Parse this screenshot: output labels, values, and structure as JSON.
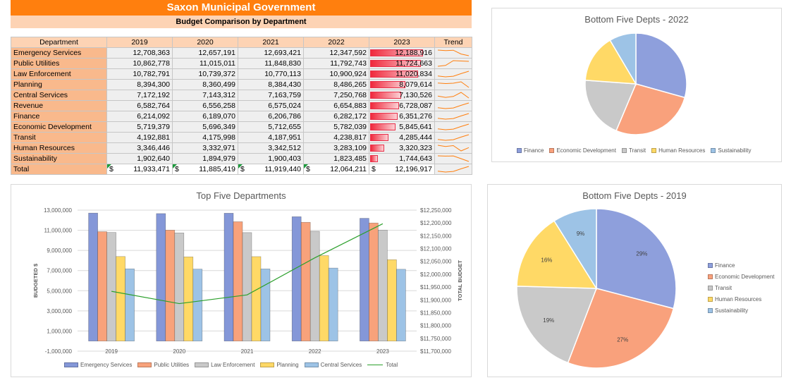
{
  "sheet": {
    "title": "Saxon Municipal Government",
    "subtitle": "Budget Comparison by Department",
    "columns": [
      "Department",
      "2019",
      "2020",
      "2021",
      "2022",
      "2023",
      "Trend"
    ],
    "rows": [
      {
        "dept": "Emergency Services",
        "vals": [
          "12,708,363",
          "12,657,191",
          "12,693,421",
          "12,347,592",
          "12,188,916"
        ],
        "v2023": 12188916,
        "trend": [
          12708363,
          12657191,
          12693421,
          12347592,
          12188916
        ]
      },
      {
        "dept": "Public Utilities",
        "vals": [
          "10,862,778",
          "11,015,011",
          "11,848,830",
          "11,792,743",
          "11,724,663"
        ],
        "v2023": 11724663,
        "trend": [
          10862778,
          11015011,
          11848830,
          11792743,
          11724663
        ]
      },
      {
        "dept": "Law Enforcement",
        "vals": [
          "10,782,791",
          "10,739,372",
          "10,770,113",
          "10,900,924",
          "11,020,834"
        ],
        "v2023": 11020834,
        "trend": [
          10782791,
          10739372,
          10770113,
          10900924,
          11020834
        ]
      },
      {
        "dept": "Planning",
        "vals": [
          "8,394,300",
          "8,360,499",
          "8,384,430",
          "8,486,265",
          "8,079,614"
        ],
        "v2023": 8079614,
        "trend": [
          8394300,
          8360499,
          8384430,
          8486265,
          8079614
        ]
      },
      {
        "dept": "Central Services",
        "vals": [
          "7,172,192",
          "7,143,312",
          "7,163,759",
          "7,250,768",
          "7,130,526"
        ],
        "v2023": 7130526,
        "trend": [
          7172192,
          7143312,
          7163759,
          7250768,
          7130526
        ]
      },
      {
        "dept": "Revenue",
        "vals": [
          "6,582,764",
          "6,556,258",
          "6,575,024",
          "6,654,883",
          "6,728,087"
        ],
        "v2023": 6728087,
        "trend": [
          6582764,
          6556258,
          6575024,
          6654883,
          6728087
        ]
      },
      {
        "dept": "Finance",
        "vals": [
          "6,214,092",
          "6,189,070",
          "6,206,786",
          "6,282,172",
          "6,351,276"
        ],
        "v2023": 6351276,
        "trend": [
          6214092,
          6189070,
          6206786,
          6282172,
          6351276
        ]
      },
      {
        "dept": "Economic Development",
        "vals": [
          "5,719,379",
          "5,696,349",
          "5,712,655",
          "5,782,039",
          "5,845,641"
        ],
        "v2023": 5845641,
        "trend": [
          5719379,
          5696349,
          5712655,
          5782039,
          5845641
        ]
      },
      {
        "dept": "Transit",
        "vals": [
          "4,192,881",
          "4,175,998",
          "4,187,951",
          "4,238,817",
          "4,285,444"
        ],
        "v2023": 4285444,
        "trend": [
          4192881,
          4175998,
          4187951,
          4238817,
          4285444
        ]
      },
      {
        "dept": "Human Resources",
        "vals": [
          "3,346,446",
          "3,332,971",
          "3,342,512",
          "3,283,109",
          "3,320,323"
        ],
        "v2023": 3320323,
        "trend": [
          3346446,
          3332971,
          3342512,
          3283109,
          3320323
        ]
      },
      {
        "dept": "Sustainability",
        "vals": [
          "1,902,640",
          "1,894,979",
          "1,900,403",
          "1,823,485",
          "1,744,643"
        ],
        "v2023": 1744643,
        "trend": [
          1902640,
          1894979,
          1900403,
          1823485,
          1744643
        ]
      }
    ],
    "total": {
      "dept": "Total",
      "currency": "$",
      "vals": [
        "11,933,471",
        "11,885,419",
        "11,919,440",
        "12,064,211",
        "12,196,917"
      ],
      "trend": [
        11933471,
        11885419,
        11919440,
        12064211,
        12196917
      ]
    },
    "colors": {
      "header_orange": "#ff7f0e",
      "dept_fill": "#f9b98c",
      "databar_red": "#f0283c",
      "sparkline": "#ff7f0e"
    }
  },
  "chart_data": [
    {
      "type": "bar",
      "title": "Top Five Departments",
      "categories": [
        "2019",
        "2020",
        "2021",
        "2022",
        "2023"
      ],
      "series": [
        {
          "name": "Emergency Services",
          "values": [
            12708363,
            12657191,
            12693421,
            12347592,
            12188916
          ],
          "color": "#8497d8"
        },
        {
          "name": "Public Utilities",
          "values": [
            10862778,
            11015011,
            11848830,
            11792743,
            11724663
          ],
          "color": "#f8a27b"
        },
        {
          "name": "Law Enforcement",
          "values": [
            10782791,
            10739372,
            10770113,
            10900924,
            11020834
          ],
          "color": "#c9c9c9"
        },
        {
          "name": "Planning",
          "values": [
            8394300,
            8360499,
            8384430,
            8486265,
            8079614
          ],
          "color": "#ffd966"
        },
        {
          "name": "Central Services",
          "values": [
            7172192,
            7143312,
            7163759,
            7250768,
            7130526
          ],
          "color": "#9dc3e6"
        }
      ],
      "line_series": {
        "name": "Total",
        "axis": "secondary",
        "values": [
          11933471,
          11885419,
          11919440,
          12064211,
          12196917
        ],
        "color": "#2ca02c"
      },
      "ylabel": "BUDGETED $",
      "y2label": "TOTAL BUDGET",
      "ylim": [
        -1000000,
        13000000
      ],
      "yticks": [
        "13,000,000",
        "11,000,000",
        "9,000,000",
        "7,000,000",
        "5,000,000",
        "3,000,000",
        "1,000,000",
        "-1,000,000"
      ],
      "y2lim": [
        11700000,
        12250000
      ],
      "y2ticks": [
        "$12,250,000",
        "$12,200,000",
        "$12,150,000",
        "$12,100,000",
        "$12,050,000",
        "$12,000,000",
        "$11,950,000",
        "$11,900,000",
        "$11,850,000",
        "$11,800,000",
        "$11,750,000",
        "$11,700,000"
      ],
      "legend": "bottom",
      "grid": true
    },
    {
      "type": "pie",
      "title": "Bottom Five Depts - 2022",
      "labels": [
        "Finance",
        "Economic Development",
        "Transit",
        "Human Resources",
        "Sustainability"
      ],
      "values": [
        6282172,
        5782039,
        4238817,
        3283109,
        1823485
      ],
      "colors": [
        "#8e9fdc",
        "#f9a17c",
        "#c9c9c9",
        "#ffd966",
        "#9dc3e6"
      ],
      "legend": "bottom"
    },
    {
      "type": "pie",
      "title": "Bottom Five Depts - 2019",
      "labels": [
        "Finance",
        "Economic Development",
        "Transit",
        "Human Resources",
        "Sustainability"
      ],
      "values": [
        6214092,
        5719379,
        4192881,
        3346446,
        1902640
      ],
      "data_labels": [
        "29%",
        "27%",
        "19%",
        "16%",
        "9%"
      ],
      "colors": [
        "#8e9fdc",
        "#f9a17c",
        "#c9c9c9",
        "#ffd966",
        "#9dc3e6"
      ],
      "legend": "right"
    }
  ]
}
